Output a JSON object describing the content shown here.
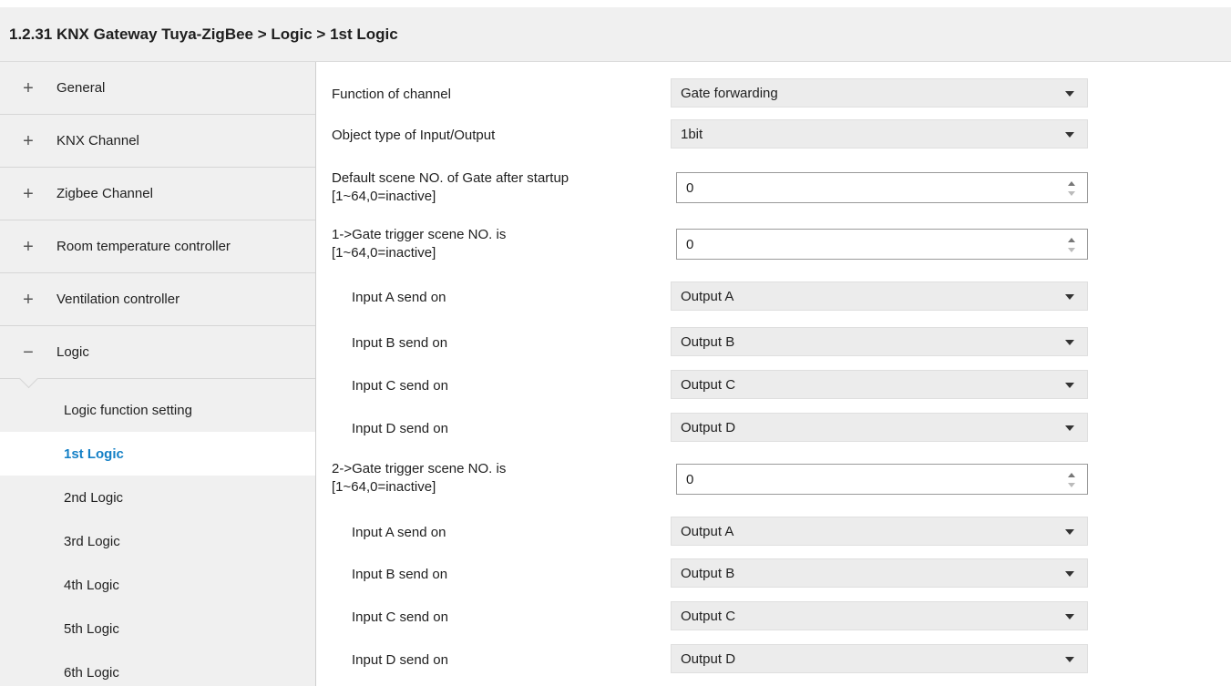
{
  "title": "1.2.31 KNX Gateway Tuya-ZigBee > Logic > 1st Logic",
  "sidebar": {
    "top_items": [
      {
        "sign": "+",
        "label": "General"
      },
      {
        "sign": "+",
        "label": "KNX Channel"
      },
      {
        "sign": "+",
        "label": "Zigbee Channel"
      },
      {
        "sign": "+",
        "label": "Room temperature controller"
      },
      {
        "sign": "+",
        "label": "Ventilation controller"
      },
      {
        "sign": "−",
        "label": "Logic"
      }
    ],
    "sub_items": [
      {
        "label": "Logic function setting"
      },
      {
        "label": "1st Logic"
      },
      {
        "label": "2nd Logic"
      },
      {
        "label": "3rd Logic"
      },
      {
        "label": "4th Logic"
      },
      {
        "label": "5th Logic"
      },
      {
        "label": "6th Logic"
      }
    ]
  },
  "params": [
    {
      "label": "Function of channel",
      "value": "Gate forwarding"
    },
    {
      "label": "Object type of Input/Output",
      "value": "1bit"
    },
    {
      "label_line1": "Default scene NO. of Gate after startup",
      "label_line2": "[1~64,0=inactive]",
      "value": "0"
    },
    {
      "label_line1": "1->Gate trigger scene NO. is",
      "label_line2": "[1~64,0=inactive]",
      "value": "0"
    },
    {
      "label": "Input A send on",
      "value": "Output A"
    },
    {
      "label": "Input B send on",
      "value": "Output B"
    },
    {
      "label": "Input C send on",
      "value": "Output C"
    },
    {
      "label": "Input D send on",
      "value": "Output D"
    },
    {
      "label_line1": "2->Gate trigger scene NO. is",
      "label_line2": "[1~64,0=inactive]",
      "value": "0"
    },
    {
      "label": "Input A send on",
      "value": "Output A"
    },
    {
      "label": "Input B send on",
      "value": "Output B"
    },
    {
      "label": "Input C send on",
      "value": "Output C"
    },
    {
      "label": "Input D send on",
      "value": "Output D"
    }
  ]
}
